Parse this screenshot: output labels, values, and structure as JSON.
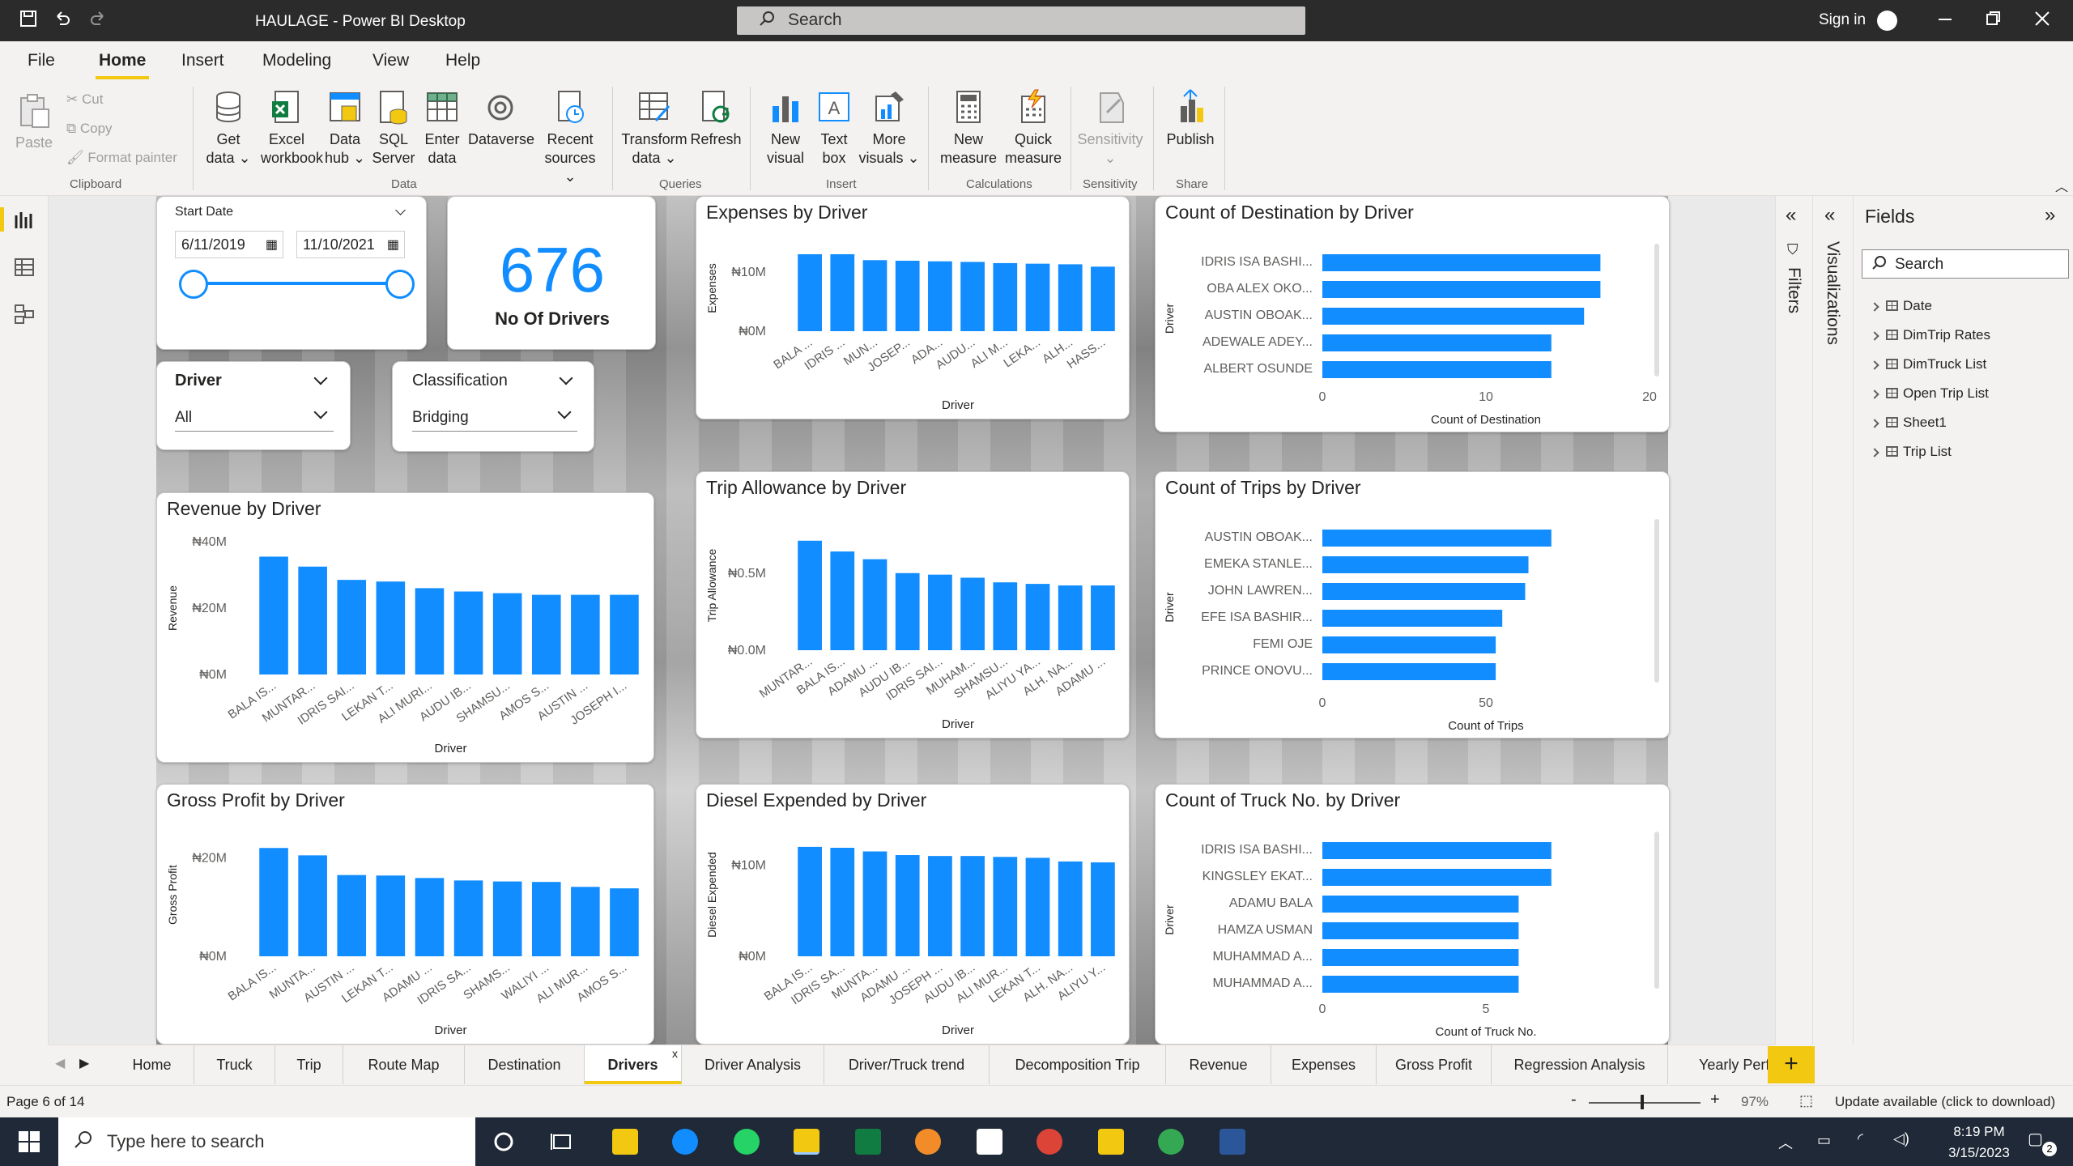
{
  "titlebar": {
    "title": "HAULAGE - Power BI Desktop",
    "search_placeholder": "Search",
    "signin": "Sign in"
  },
  "menu": {
    "tabs": [
      "File",
      "Home",
      "Insert",
      "Modeling",
      "View",
      "Help"
    ],
    "active": "Home"
  },
  "ribbon": {
    "clipboard": {
      "paste": "Paste",
      "cut": "Cut",
      "copy": "Copy",
      "format_painter": "Format painter",
      "group": "Clipboard"
    },
    "data": {
      "group": "Data",
      "buttons": [
        {
          "l1": "Get",
          "l2": "data ⌄"
        },
        {
          "l1": "Excel",
          "l2": "workbook"
        },
        {
          "l1": "Data",
          "l2": "hub ⌄"
        },
        {
          "l1": "SQL",
          "l2": "Server"
        },
        {
          "l1": "Enter",
          "l2": "data"
        },
        {
          "l1": "Dataverse",
          "l2": ""
        },
        {
          "l1": "Recent",
          "l2": "sources ⌄"
        }
      ]
    },
    "queries": {
      "group": "Queries",
      "buttons": [
        {
          "l1": "Transform",
          "l2": "data ⌄"
        },
        {
          "l1": "Refresh",
          "l2": ""
        }
      ]
    },
    "insert": {
      "group": "Insert",
      "buttons": [
        {
          "l1": "New",
          "l2": "visual"
        },
        {
          "l1": "Text",
          "l2": "box"
        },
        {
          "l1": "More",
          "l2": "visuals ⌄"
        }
      ]
    },
    "calculations": {
      "group": "Calculations",
      "buttons": [
        {
          "l1": "New",
          "l2": "measure"
        },
        {
          "l1": "Quick",
          "l2": "measure"
        }
      ]
    },
    "sensitivity": {
      "group": "Sensitivity",
      "button": "Sensitivity"
    },
    "share": {
      "group": "Share",
      "button": "Publish"
    }
  },
  "slicers": {
    "date": {
      "label": "Start Date",
      "from": "6/11/2019",
      "to": "11/10/2021"
    },
    "driver": {
      "label": "Driver",
      "value": "All"
    },
    "classification": {
      "label": "Classification",
      "value": "Bridging"
    }
  },
  "kpi": {
    "value": "676",
    "label": "No Of Drivers"
  },
  "chart_data": [
    {
      "id": "expenses",
      "type": "bar",
      "title": "Expenses by Driver",
      "xlabel": "Driver",
      "ylabel": "Expenses",
      "yticks": [
        "₦10M",
        "₦0M"
      ],
      "ytick_values": [
        10,
        0
      ],
      "ylim": [
        0,
        14.5
      ],
      "unit": "₦M",
      "categories": [
        "BALA ...",
        "IDRIS ...",
        "MUN...",
        "JOSEP...",
        "ADA...",
        "AUDU...",
        "ALI M...",
        "LEKA...",
        "ALH...",
        "HASS..."
      ],
      "values": [
        13.0,
        13.0,
        12.0,
        11.9,
        11.8,
        11.7,
        11.5,
        11.4,
        11.3,
        10.9
      ]
    },
    {
      "id": "destination",
      "type": "hbar",
      "title": "Count of Destination by Driver",
      "xlabel": "Count of Destination",
      "ylabel": "Driver",
      "xticks": [
        0,
        10,
        20
      ],
      "xlim": [
        0,
        20
      ],
      "categories": [
        "IDRIS ISA BASHI...",
        "OBA ALEX OKO...",
        "AUSTIN OBOAK...",
        "ADEWALE ADEY...",
        "ALBERT OSUNDE"
      ],
      "values": [
        17,
        17,
        16,
        14,
        14
      ]
    },
    {
      "id": "revenue",
      "type": "bar",
      "title": "Revenue by Driver",
      "xlabel": "Driver",
      "ylabel": "Revenue",
      "yticks": [
        "₦40M",
        "₦20M",
        "₦0M"
      ],
      "ytick_values": [
        40,
        20,
        0
      ],
      "ylim": [
        0,
        40
      ],
      "unit": "₦M",
      "categories": [
        "BALA IS...",
        "MUNTAR...",
        "IDRIS SAI...",
        "LEKAN T...",
        "ALI MURI...",
        "AUDU IB...",
        "SHAMSU...",
        "AMOS S...",
        "AUSTIN ...",
        "JOSEPH I..."
      ],
      "values": [
        35.5,
        32.5,
        28.5,
        28.0,
        26.0,
        25.0,
        24.5,
        24.0,
        24.0,
        24.0
      ]
    },
    {
      "id": "trip_allowance",
      "type": "bar",
      "title": "Trip Allowance by Driver",
      "xlabel": "Driver",
      "ylabel": "Trip Allowance",
      "yticks": [
        "₦0.5M",
        "₦0.0M"
      ],
      "ytick_values": [
        0.5,
        0.0
      ],
      "ylim": [
        0,
        0.84
      ],
      "unit": "₦M",
      "categories": [
        "MUNTAR...",
        "BALA IS...",
        "ADAMU ...",
        "AUDU IB...",
        "IDRIS SAI...",
        "MUHAM...",
        "SHAMSU...",
        "ALIYU YA...",
        "ALH. NA...",
        "ADAMU ..."
      ],
      "values": [
        0.71,
        0.64,
        0.59,
        0.5,
        0.49,
        0.47,
        0.44,
        0.43,
        0.42,
        0.42
      ]
    },
    {
      "id": "trips",
      "type": "hbar",
      "title": "Count of Trips by Driver",
      "xlabel": "Count of Trips",
      "ylabel": "Driver",
      "xticks": [
        0,
        50
      ],
      "xlim": [
        0,
        100
      ],
      "categories": [
        "AUSTIN OBOAK...",
        "EMEKA STANLE...",
        "JOHN LAWREN...",
        "EFE ISA BASHIR...",
        "FEMI OJE",
        "PRINCE ONOVU..."
      ],
      "values": [
        70,
        63,
        62,
        55,
        53,
        53
      ]
    },
    {
      "id": "gross_profit",
      "type": "bar",
      "title": "Gross Profit by Driver",
      "xlabel": "Driver",
      "ylabel": "Gross Profit",
      "yticks": [
        "₦20M",
        "₦0M"
      ],
      "ytick_values": [
        20,
        0
      ],
      "ylim": [
        0,
        25
      ],
      "unit": "₦M",
      "categories": [
        "BALA IS...",
        "MUNTA...",
        "AUSTIN ...",
        "LEKAN T...",
        "ADAMU ...",
        "IDRIS SA...",
        "SHAMS...",
        "WALIYI ...",
        "ALI MUR...",
        "AMOS S..."
      ],
      "values": [
        22.0,
        20.5,
        16.5,
        16.4,
        15.9,
        15.4,
        15.2,
        15.1,
        14.1,
        13.8
      ]
    },
    {
      "id": "diesel",
      "type": "bar",
      "title": "Diesel Expended by Driver",
      "xlabel": "Driver",
      "ylabel": "Diesel Expended",
      "yticks": [
        "₦10M",
        "₦0M"
      ],
      "ytick_values": [
        10,
        0
      ],
      "ylim": [
        0,
        13.5
      ],
      "unit": "₦M",
      "categories": [
        "BALA IS...",
        "IDRIS SA...",
        "MUNTA...",
        "ADAMU ...",
        "JOSEPH ...",
        "AUDU IB...",
        "ALI MUR...",
        "LEKAN T...",
        "ALH. NA...",
        "ALIYU Y..."
      ],
      "values": [
        12.0,
        11.9,
        11.5,
        11.1,
        11.0,
        11.0,
        10.9,
        10.8,
        10.4,
        10.3
      ]
    },
    {
      "id": "trucks",
      "type": "hbar",
      "title": "Count of Truck No. by Driver",
      "xlabel": "Count of Truck No.",
      "ylabel": "Driver",
      "xticks": [
        0,
        5
      ],
      "xlim": [
        0,
        10
      ],
      "categories": [
        "IDRIS ISA BASHI...",
        "KINGSLEY EKAT...",
        "ADAMU BALA",
        "HAMZA USMAN",
        "MUHAMMAD A...",
        "MUHAMMAD A..."
      ],
      "values": [
        7,
        7,
        6,
        6,
        6,
        6
      ]
    }
  ],
  "panes": {
    "filters": "Filters",
    "visualizations": "Visualizations",
    "fields": "Fields",
    "fields_search": "Search",
    "field_tables": [
      "Date",
      "DimTrip Rates",
      "DimTruck List",
      "Open Trip List",
      "Sheet1",
      "Trip List"
    ]
  },
  "pagetabs": [
    "Home",
    "Truck",
    "Trip",
    "Route Map",
    "Destination",
    "Drivers",
    "Driver Analysis",
    "Driver/Truck trend",
    "Decomposition Trip",
    "Revenue",
    "Expenses",
    "Gross Profit",
    "Regression Analysis",
    "Yearly Perf"
  ],
  "active_page": "Drivers",
  "status": {
    "page": "Page 6 of 14",
    "zoom": "97%",
    "update": "Update available (click to download)"
  },
  "taskbar": {
    "search": "Type here to search",
    "time": "8:19 PM",
    "date": "3/15/2023",
    "notif": "2"
  },
  "colors": {
    "bar": "#118dff",
    "accent": "#f2c811"
  }
}
